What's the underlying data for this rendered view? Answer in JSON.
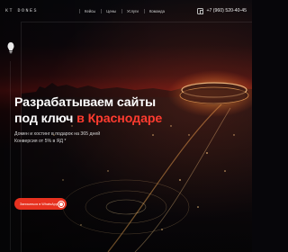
{
  "header": {
    "logo": "КТ DONES",
    "nav": [
      "Кейсы",
      "Цены",
      "Услуги",
      "Команда"
    ],
    "phone": "+7 (960) 520-40-45",
    "phone_icon": "phone-icon"
  },
  "hero": {
    "title_line1": "Разрабатываем сайты",
    "title_line2_plain": "под ключ ",
    "title_line2_accent": "в Краснодаре",
    "sub_line1": "Домен и хостинг в подарок на 365 дней",
    "sub_line2": "Конверсия от 5% в ЯД *"
  },
  "cta": {
    "label": "Записаться в WhatsApp",
    "icon": "whatsapp-icon"
  },
  "colors": {
    "accent": "#ff3b2f",
    "button": "#e7311f"
  }
}
